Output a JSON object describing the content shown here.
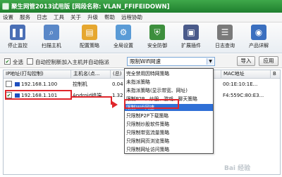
{
  "window": {
    "title": "聚生网管2013试用版 [网段名称: VLAN_FFIFEIDOWN]"
  },
  "menu": [
    "设置",
    "服务",
    "日志",
    "工具",
    "关于",
    "升级",
    "帮助",
    "远程协助"
  ],
  "toolbar": [
    {
      "label": "停止监控",
      "icon": "pause-icon",
      "color": "#4a6fb5"
    },
    {
      "label": "扫描主机",
      "icon": "scan-host-icon",
      "color": "#5a88c8"
    },
    {
      "label": "配置策略",
      "icon": "config-policy-icon",
      "color": "#e6a72f"
    },
    {
      "label": "全局设置",
      "icon": "global-settings-icon",
      "color": "#5a9bd6"
    },
    {
      "label": "安全防御",
      "icon": "shield-icon",
      "color": "#3d8f3d"
    },
    {
      "label": "扩展插件",
      "icon": "plugin-icon",
      "color": "#4a5a8a"
    },
    {
      "label": "日志查询",
      "icon": "log-icon",
      "color": "#7a7a7a"
    },
    {
      "label": "产品详解",
      "icon": "product-icon",
      "color": "#3a6fbf"
    }
  ],
  "options": {
    "select_all": "全选",
    "select_all_checked": true,
    "auto_control": "自动控制新加入主机并自动指派",
    "auto_control_checked": false,
    "policy_dropdown_value": "限制Wifi网速",
    "import_button": "导入",
    "apply_button": "应用"
  },
  "table": {
    "headers": [
      "IP地址(打勾控制)",
      "主机名(点...",
      "(总)",
      "MAC地址",
      "B"
    ],
    "rows": [
      {
        "ip": "192.168.1.100",
        "checked": false,
        "host": "控制机",
        "total": "0.04",
        "mac": "00:1E:10:1E..."
      },
      {
        "ip": "192.168.1.101",
        "checked": true,
        "host": "Android终端",
        "total": "1.32",
        "mac": "F4:559C:80:E3..."
      }
    ]
  },
  "dropdown_list": {
    "items": [
      "完全禁用因特网策略",
      "未指派策略",
      "未指派策略(显示带宽、网址)",
      "限制P2P、炒股、游戏、聊天策略",
      "限制Wifi网速",
      "只限制P2P下载策略",
      "只限制炒股软件策略",
      "只限制带宽流量策略",
      "只限制网页浏览策略",
      "只限制网址访问策略"
    ],
    "selected_index": 4
  },
  "watermark": "Bai 经验"
}
